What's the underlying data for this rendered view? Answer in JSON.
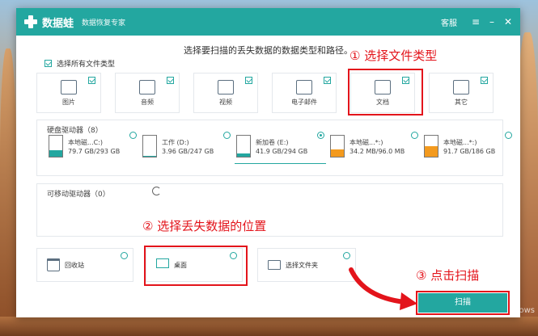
{
  "titlebar": {
    "app_name": "数据蛙",
    "app_sub": "数据恢复专家",
    "support_label": "客服",
    "menu_icon": "menu-icon",
    "minimize_icon": "minimize-icon",
    "close_icon": "close-icon"
  },
  "instruction": "选择要扫描的丢失数据的数据类型和路径。",
  "select_all_label": "选择所有文件类型",
  "file_types": [
    {
      "label": "图片",
      "checked": true,
      "icon": "image-icon"
    },
    {
      "label": "音频",
      "checked": true,
      "icon": "music-icon"
    },
    {
      "label": "视频",
      "checked": true,
      "icon": "video-icon"
    },
    {
      "label": "电子邮件",
      "checked": true,
      "icon": "email-icon"
    },
    {
      "label": "文档",
      "checked": true,
      "icon": "document-icon"
    },
    {
      "label": "其它",
      "checked": true,
      "icon": "other-icon"
    }
  ],
  "hard_drives": {
    "title": "硬盘驱动器（8）",
    "items": [
      {
        "name": "本地磁...C:)",
        "size": "79.7 GB/293 GB",
        "fill": 0.73,
        "color": "#23a7a0",
        "selected": false
      },
      {
        "name": "工作 (D:)",
        "size": "3.96 GB/247 GB",
        "fill": 0.02,
        "color": "#23a7a0",
        "selected": false
      },
      {
        "name": "新加卷 (E:)",
        "size": "41.9 GB/294 GB",
        "fill": 0.14,
        "color": "#23a7a0",
        "selected": true
      },
      {
        "name": "本地磁...*:)",
        "size": "34.2 MB/96.0 MB",
        "fill": 0.36,
        "color": "#f39a1e",
        "selected": false
      },
      {
        "name": "本地磁...*:)",
        "size": "91.7 GB/186 GB",
        "fill": 0.49,
        "color": "#f39a1e",
        "selected": false
      }
    ]
  },
  "removable_drives": {
    "title": "可移动驱动器（0）",
    "refresh_icon": "refresh-icon"
  },
  "locations": [
    {
      "label": "回收站",
      "icon": "trash-icon"
    },
    {
      "label": "桌面",
      "icon": "desktop-icon"
    },
    {
      "label": "选择文件夹",
      "icon": "folder-icon"
    }
  ],
  "scan_button": "扫描",
  "annotations": {
    "step1": "① 选择文件类型",
    "step2": "② 选择丢失数据的位置",
    "step3": "③ 点击扫描"
  },
  "watermark": "激活 Windows",
  "colors": {
    "accent": "#23a7a0",
    "annotation": "#e3141b",
    "warning_drive": "#f39a1e"
  }
}
